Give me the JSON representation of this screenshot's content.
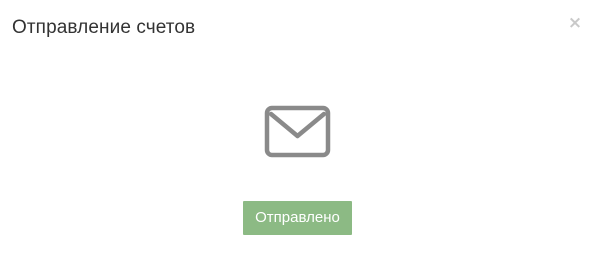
{
  "dialog": {
    "title": "Отправление счетов",
    "close_label": "×"
  },
  "status": {
    "icon": "envelope-icon",
    "button_label": "Отправлено",
    "button_color": "#8cba84"
  },
  "colors": {
    "icon_stroke": "#8a8a8a",
    "title_text": "#333333",
    "close_icon": "#c9c9c9"
  }
}
